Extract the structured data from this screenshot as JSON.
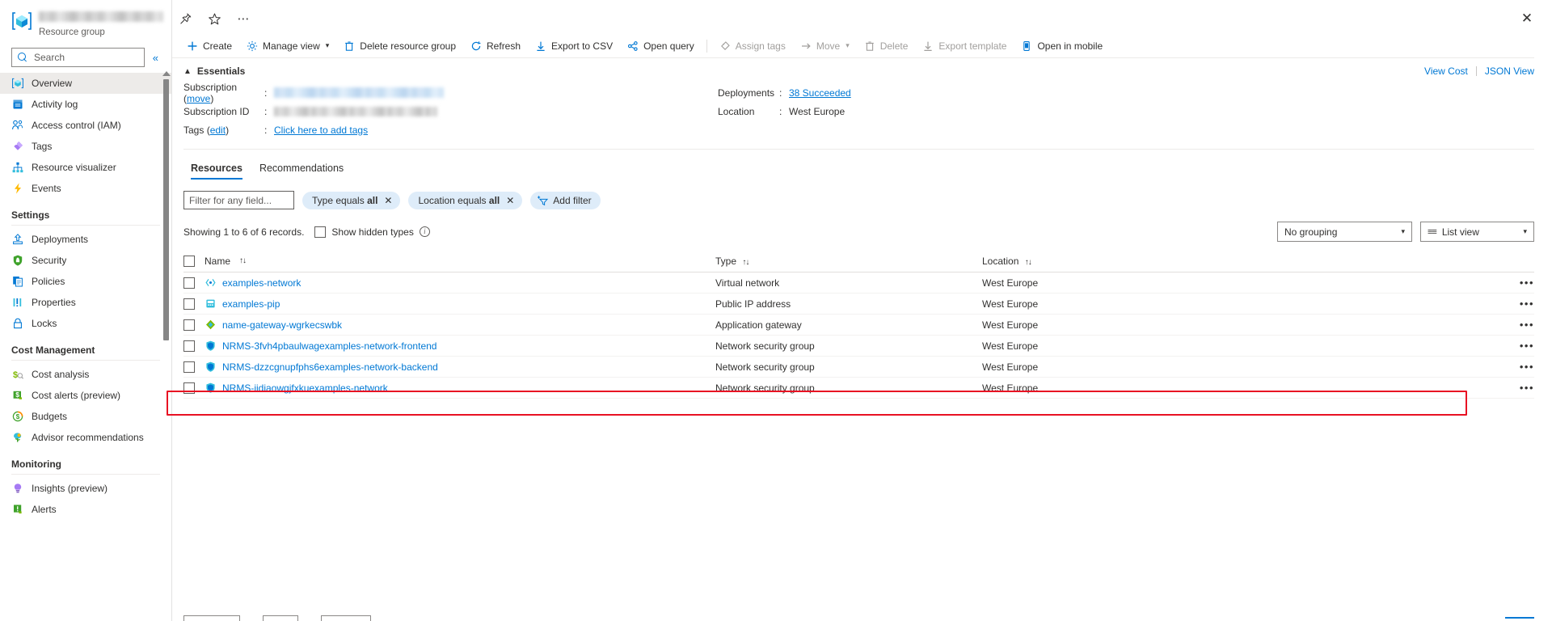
{
  "sidebar": {
    "resource_group_label": "Resource group",
    "search_placeholder": "Search",
    "search_value": "",
    "collapse_icon": "chevron-double-left",
    "items": [
      {
        "label": "Overview",
        "icon": "resource-group-icon",
        "selected": true
      },
      {
        "label": "Activity log",
        "icon": "activity-log-icon",
        "selected": false
      },
      {
        "label": "Access control (IAM)",
        "icon": "access-control-icon",
        "selected": false
      },
      {
        "label": "Tags",
        "icon": "tags-icon",
        "selected": false
      },
      {
        "label": "Resource visualizer",
        "icon": "resource-visualizer-icon",
        "selected": false
      },
      {
        "label": "Events",
        "icon": "events-icon",
        "selected": false
      }
    ],
    "groups": [
      {
        "title": "Settings",
        "items": [
          {
            "label": "Deployments",
            "icon": "deployments-icon"
          },
          {
            "label": "Security",
            "icon": "security-shield-icon"
          },
          {
            "label": "Policies",
            "icon": "policies-icon"
          },
          {
            "label": "Properties",
            "icon": "properties-icon"
          },
          {
            "label": "Locks",
            "icon": "lock-icon"
          }
        ]
      },
      {
        "title": "Cost Management",
        "items": [
          {
            "label": "Cost analysis",
            "icon": "cost-analysis-icon"
          },
          {
            "label": "Cost alerts (preview)",
            "icon": "cost-alerts-icon"
          },
          {
            "label": "Budgets",
            "icon": "budgets-icon"
          },
          {
            "label": "Advisor recommendations",
            "icon": "advisor-icon"
          }
        ]
      },
      {
        "title": "Monitoring",
        "items": [
          {
            "label": "Insights (preview)",
            "icon": "insights-icon"
          },
          {
            "label": "Alerts",
            "icon": "alerts-icon"
          }
        ]
      }
    ]
  },
  "topbar": {
    "pin_icon": "pin-icon",
    "favorite_icon": "star-icon",
    "more_icon": "ellipsis-icon",
    "close_icon": "close-icon"
  },
  "commandbar": {
    "items": [
      {
        "label": "Create",
        "icon": "plus-icon",
        "disabled": false,
        "chevron": false
      },
      {
        "label": "Manage view",
        "icon": "gear-icon",
        "disabled": false,
        "chevron": true
      },
      {
        "label": "Delete resource group",
        "icon": "trash-icon",
        "disabled": false,
        "chevron": false
      },
      {
        "label": "Refresh",
        "icon": "refresh-icon",
        "disabled": false,
        "chevron": false
      },
      {
        "label": "Export to CSV",
        "icon": "download-icon",
        "disabled": false,
        "chevron": false
      },
      {
        "label": "Open query",
        "icon": "open-query-icon",
        "disabled": false,
        "chevron": false
      },
      {
        "label": "Assign tags",
        "icon": "tag-icon",
        "disabled": true,
        "chevron": false
      },
      {
        "label": "Move",
        "icon": "arrow-right-icon",
        "disabled": true,
        "chevron": true
      },
      {
        "label": "Delete",
        "icon": "trash-icon",
        "disabled": true,
        "chevron": false
      },
      {
        "label": "Export template",
        "icon": "download-icon",
        "disabled": true,
        "chevron": false
      },
      {
        "label": "Open in mobile",
        "icon": "mobile-icon",
        "disabled": false,
        "chevron": false
      }
    ]
  },
  "essentials": {
    "title": "Essentials",
    "view_cost_label": "View Cost",
    "json_view_label": "JSON View",
    "left_rows": [
      {
        "key": "Subscription",
        "key_link": "move",
        "colon": ":",
        "value": "",
        "redacted": "blue"
      },
      {
        "key": "Subscription ID",
        "key_link": "",
        "colon": ":",
        "value": "",
        "redacted": "gray"
      },
      {
        "key": "Tags",
        "key_link": "edit",
        "colon": ":",
        "value": "Click here to add tags",
        "redacted": ""
      }
    ],
    "right_rows": [
      {
        "key": "Deployments",
        "colon": ":",
        "value": "38 Succeeded",
        "is_link": true
      },
      {
        "key": "Location",
        "colon": ":",
        "value": "West Europe",
        "is_link": false
      }
    ]
  },
  "tabs": [
    {
      "label": "Resources",
      "active": true
    },
    {
      "label": "Recommendations",
      "active": false
    }
  ],
  "filters": {
    "text_placeholder": "Filter for any field...",
    "text_value": "",
    "pills": [
      {
        "prefix": "Type equals",
        "value": "all",
        "close": "✕"
      },
      {
        "prefix": "Location equals",
        "value": "all",
        "close": "✕"
      }
    ],
    "add_filter_label": "Add filter"
  },
  "records": {
    "showing_text": "Showing 1 to 6 of 6 records.",
    "show_hidden_types_label": "Show hidden types",
    "show_hidden_checked": false,
    "info_icon": "info-icon",
    "grouping_value": "No grouping",
    "view_value": "List view"
  },
  "table": {
    "columns": [
      {
        "label": "Name",
        "sortable": true
      },
      {
        "label": "Type",
        "sortable": true
      },
      {
        "label": "Location",
        "sortable": true
      }
    ],
    "rows": [
      {
        "name": "examples-network",
        "type": "Virtual network",
        "location": "West Europe",
        "icon": "virtual-network-icon",
        "highlighted": false
      },
      {
        "name": "examples-pip",
        "type": "Public IP address",
        "location": "West Europe",
        "icon": "public-ip-icon",
        "highlighted": false
      },
      {
        "name": "name-gateway-wgrkecswbk",
        "type": "Application gateway",
        "location": "West Europe",
        "icon": "application-gateway-icon",
        "highlighted": true
      },
      {
        "name": "NRMS-3fvh4pbaulwagexamples-network-frontend",
        "type": "Network security group",
        "location": "West Europe",
        "icon": "network-security-group-icon",
        "highlighted": false
      },
      {
        "name": "NRMS-dzzcgnupfphs6examples-network-backend",
        "type": "Network security group",
        "location": "West Europe",
        "icon": "network-security-group-icon",
        "highlighted": false
      },
      {
        "name": "NRMS-iidiaowgjfxkuexamples-network",
        "type": "Network security group",
        "location": "West Europe",
        "icon": "network-security-group-icon",
        "highlighted": false
      }
    ],
    "row_more_icon": "•••"
  },
  "colors": {
    "accent": "#0078d4",
    "highlight": "#e81123",
    "pill_bg": "#deecf9",
    "selected_nav": "#edebe9"
  }
}
